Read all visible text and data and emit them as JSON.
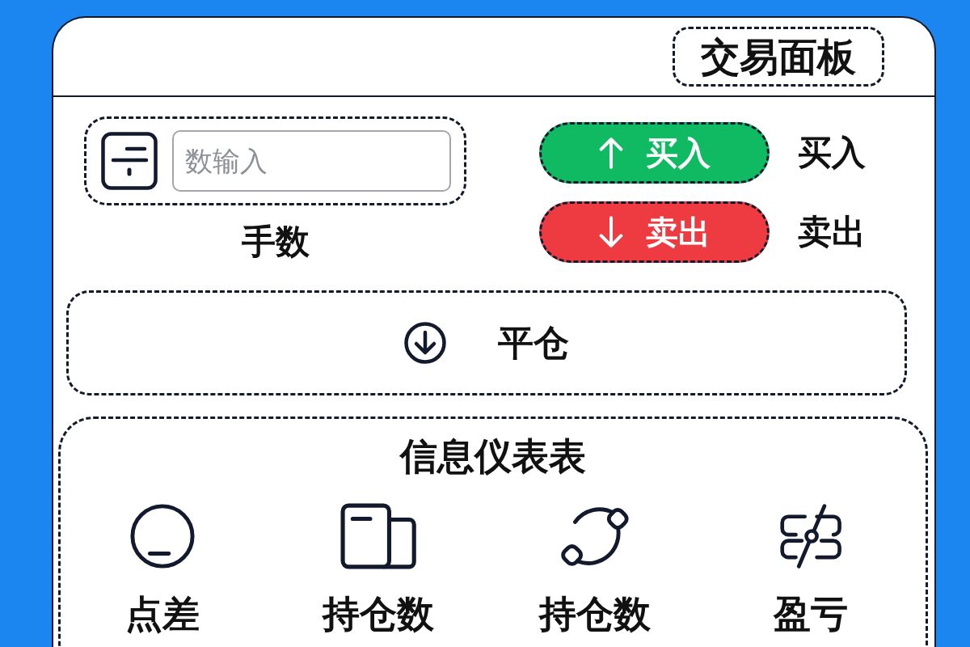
{
  "header": {
    "title": "交易面板"
  },
  "quantity": {
    "placeholder": "数输入",
    "label": "手数"
  },
  "orders": [
    {
      "kind": "buy",
      "label": "买入",
      "side_label": "买入"
    },
    {
      "kind": "sell",
      "label": "卖出",
      "side_label": "卖出"
    }
  ],
  "close_position": {
    "label": "平仓"
  },
  "dashboard": {
    "title": "信息仪表表",
    "items": [
      {
        "kind": "spread",
        "label": "点差"
      },
      {
        "kind": "cards",
        "label": "持仓数"
      },
      {
        "kind": "cycle",
        "label": "持仓数"
      },
      {
        "kind": "split",
        "label": "盈亏"
      }
    ]
  }
}
